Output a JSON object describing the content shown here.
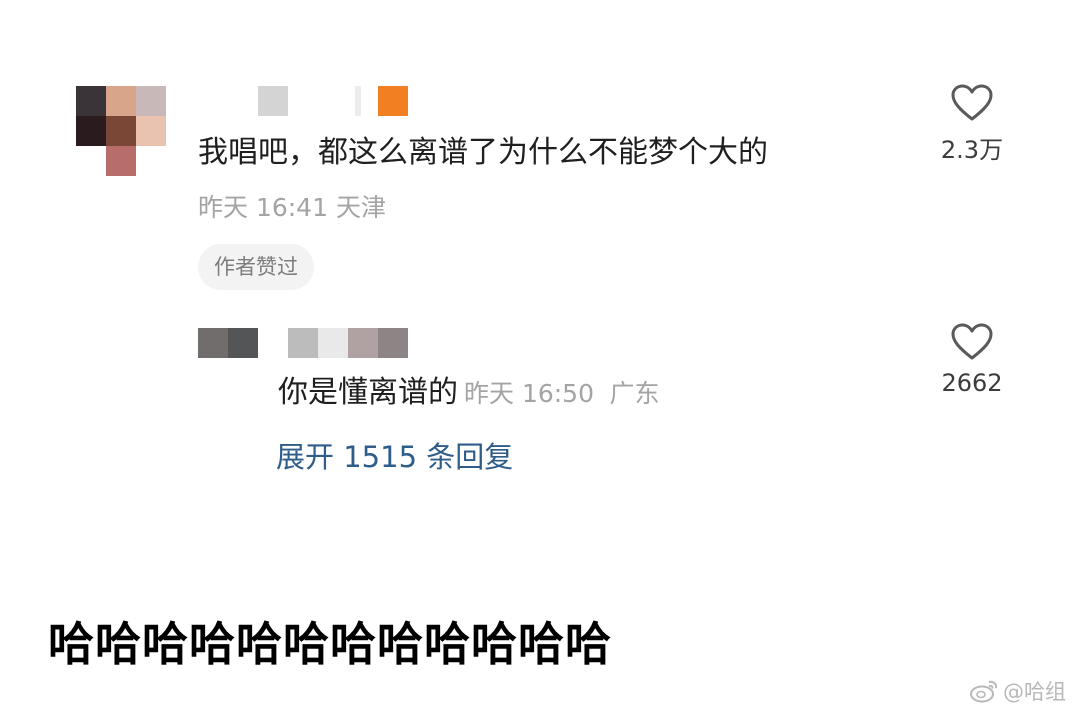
{
  "comment": {
    "text": "我唱吧，都这么离谱了为什么不能梦个大的",
    "time": "昨天 16:41",
    "location": "天津",
    "badge": "作者赞过",
    "likes": "2.3万"
  },
  "reply": {
    "text": "你是懂离谱的",
    "time": "昨天 16:50",
    "location": "广东",
    "likes": "2662"
  },
  "expand_replies": "展开 1515 条回复",
  "caption": "哈哈哈哈哈哈哈哈哈哈哈哈",
  "watermark": "@哈组",
  "colors": {
    "link": "#2e5d8a",
    "meta_text": "#a4a4a4"
  },
  "icons": [
    "heart-icon",
    "weibo-icon"
  ]
}
